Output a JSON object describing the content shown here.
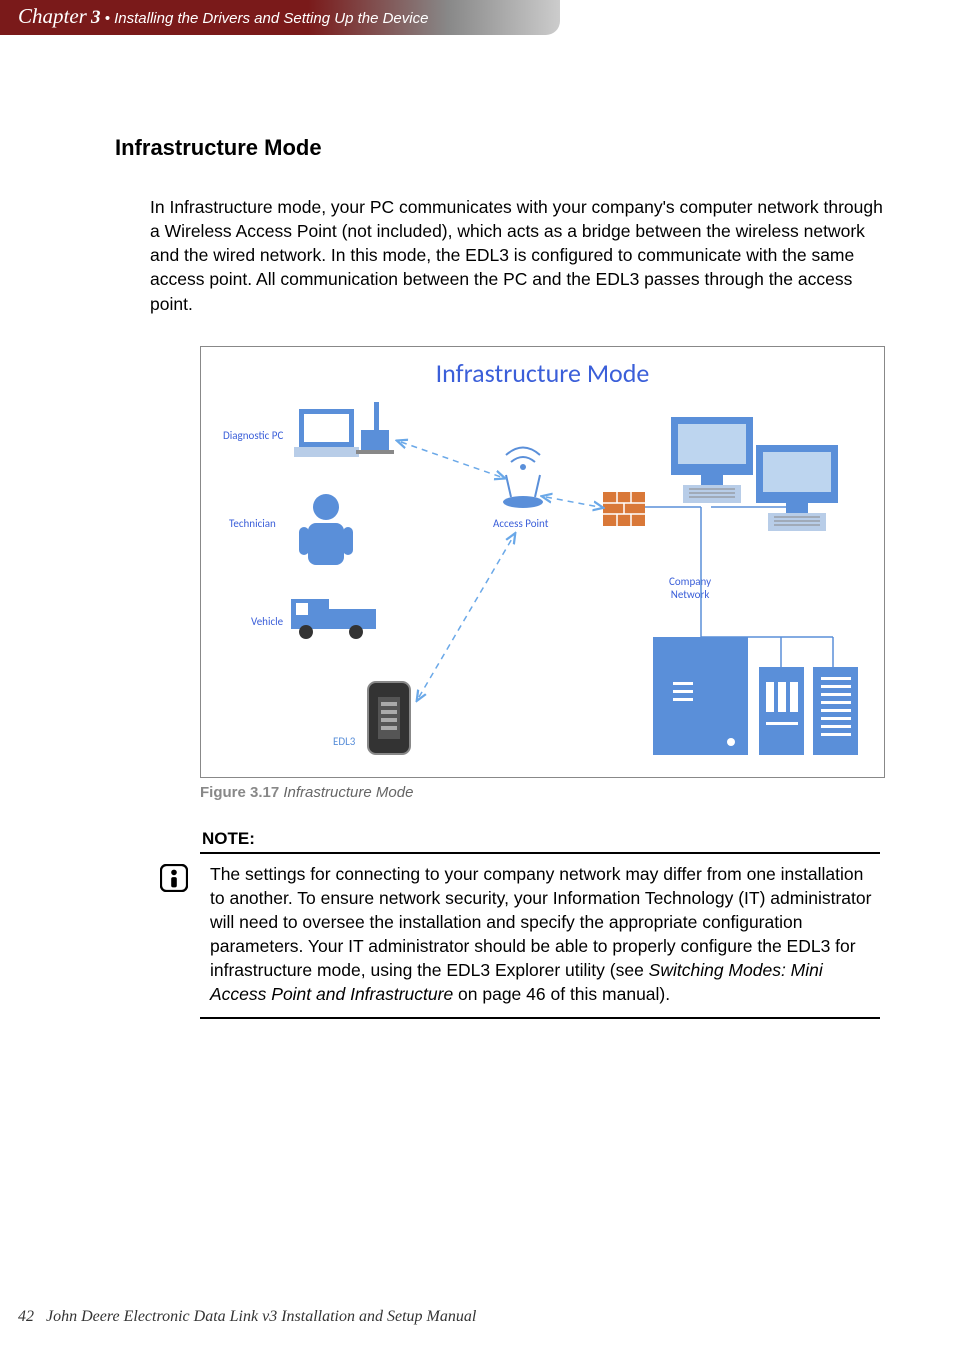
{
  "chapter": {
    "word": "Chapter",
    "number": "3",
    "separator": "•",
    "title": "Installing the Drivers and Setting Up the Device"
  },
  "heading": "Infrastructure Mode",
  "paragraph": "In Infrastructure mode, your PC communicates with your company's computer network through a Wireless Access Point (not included), which acts as a bridge between the wireless network and the wired network.  In this mode, the EDL3 is configured to communicate with the same access point.  All communication between the PC and the EDL3 passes through the access point.",
  "figure": {
    "title": "Infrastructure Mode",
    "labels": {
      "diagnostic_pc": "Diagnostic PC",
      "technician": "Technician",
      "vehicle": "Vehicle",
      "edl3": "EDL3",
      "access_point": "Access Point",
      "company_network": "Company\nNetwork"
    },
    "caption_num": "Figure 3.17",
    "caption_title": "Infrastructure Mode"
  },
  "note": {
    "label": "NOTE:",
    "text_1": "The settings for connecting to your company network may differ from one installation to another. To ensure network security, your Information Technology (IT) administrator will need to oversee the installation and specify the appropriate configuration parameters.  Your IT administrator should be able to properly configure the EDL3 for infrastructure mode, using the EDL3 Explorer utility (see ",
    "text_italic": "Switching Modes: Mini Access Point and Infrastructure",
    "text_2": " on page 46 of this manual)."
  },
  "footer": {
    "page": "42",
    "title": "John Deere Electronic Data Link v3 Installation and Setup Manual"
  }
}
